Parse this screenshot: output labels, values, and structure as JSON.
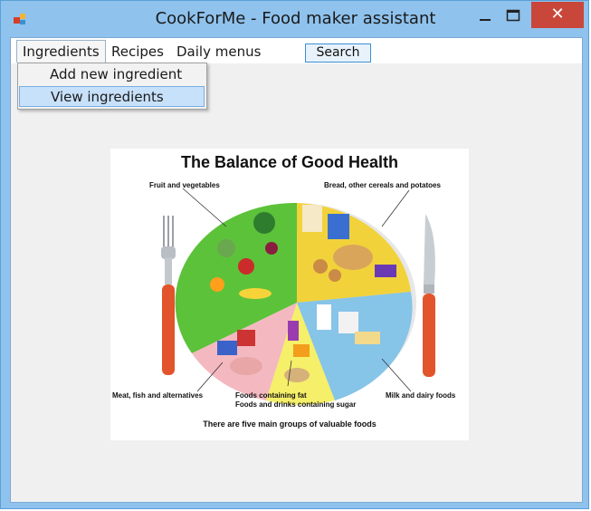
{
  "window": {
    "title": "CookForMe - Food maker assistant",
    "close_glyph": "✕"
  },
  "menu": {
    "items": [
      {
        "label": "Ingredients",
        "open": true
      },
      {
        "label": "Recipes"
      },
      {
        "label": "Daily menus"
      }
    ],
    "search_label": "Search"
  },
  "dropdown": {
    "items": [
      {
        "label": "Add new ingredient"
      },
      {
        "label": "View ingredients",
        "highlighted": true
      }
    ]
  },
  "poster": {
    "title": "The Balance of Good Health",
    "labels": {
      "fruit_veg": "Fruit and vegetables",
      "bread": "Bread, other cereals and potatoes",
      "meat": "Meat, fish and alternatives",
      "fat_line1": "Foods containing fat",
      "fat_line2": "Foods and drinks containing sugar",
      "milk": "Milk and dairy foods"
    },
    "footer": "There are five main groups of valuable foods",
    "colors": {
      "green": "#5cc23a",
      "yellow": "#f2d23a",
      "blue": "#86c4e8",
      "pink": "#f4b9c0",
      "purple": "#a98bc7",
      "cutlery_handle": "#e2542b"
    }
  },
  "colors": {
    "title_bar": "#8fc2ed",
    "close_button": "#c9473a",
    "client_bg": "#f0f0f0"
  }
}
